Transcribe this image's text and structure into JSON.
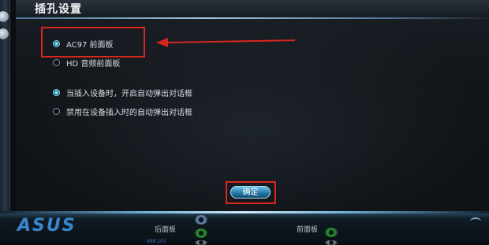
{
  "dialog": {
    "title": "插孔设置",
    "options": [
      {
        "label": "AC97 前面板",
        "checked": true
      },
      {
        "label": "HD 音频前面板",
        "checked": false
      },
      {
        "label": "当插入设备时，开启自动弹出对话框",
        "checked": true
      },
      {
        "label": "禁用在设备插入时的自动弹出对话框",
        "checked": false
      }
    ],
    "ok_label": "确定"
  },
  "bottom": {
    "brand": "ASUS",
    "back_panel_label": "后面板",
    "front_panel_label": "前面板",
    "small_text": "888.101"
  },
  "colors": {
    "highlight": "#d8261d",
    "accent": "#2e8fb3"
  }
}
